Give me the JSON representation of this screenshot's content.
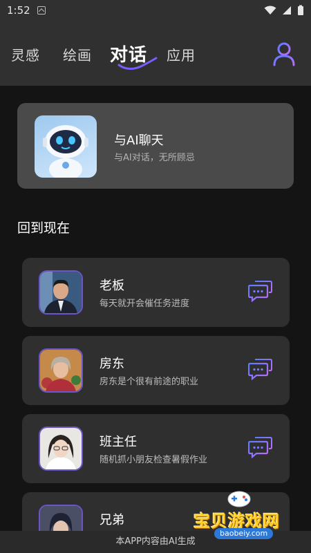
{
  "status_bar": {
    "time": "1:52"
  },
  "tabs": [
    {
      "label": "灵感"
    },
    {
      "label": "绘画"
    },
    {
      "label": "对话"
    },
    {
      "label": "应用"
    }
  ],
  "hero": {
    "title": "与AI聊天",
    "subtitle": "与AI对话，无所顾忌"
  },
  "section_title": "回到现在",
  "characters": [
    {
      "name": "老板",
      "desc": "每天就开会催任务进度"
    },
    {
      "name": "房东",
      "desc": "房东是个很有前途的职业"
    },
    {
      "name": "班主任",
      "desc": "随机抓小朋友检查暑假作业"
    },
    {
      "name": "兄弟",
      "desc": ""
    }
  ],
  "footer": "本APP内容由AI生成",
  "watermark": {
    "text": "宝贝游戏网",
    "url": "baobeiy.com"
  },
  "colors": {
    "accent": "#7a5cff",
    "background": "#141414",
    "card": "#2f2f2f"
  }
}
